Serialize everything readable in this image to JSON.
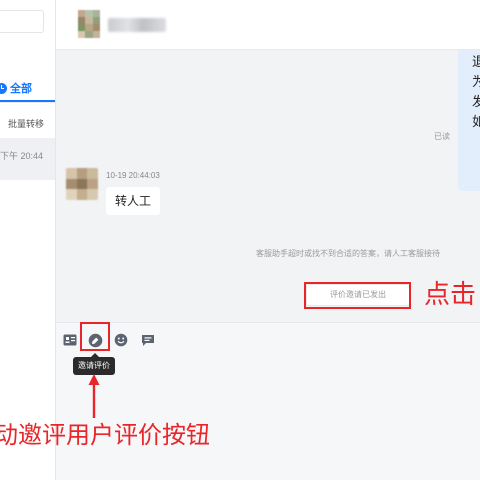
{
  "left_panel": {
    "active_tab": "全部",
    "batch_transfer": "批量转移",
    "conversation_time": "下午 20:44"
  },
  "header": {
    "contact_name": ""
  },
  "messages": {
    "outgoing_lines": [
      "退",
      "为",
      "发",
      "如"
    ],
    "read_status": "已读",
    "incoming_time": "10-19 20:44:03",
    "incoming_text": "转人工",
    "system_notice": "客服助手超时或找不到合适的答案，请人工客服接待",
    "invite_sent": "评价邀请已发出"
  },
  "toolbar": {
    "tooltip": "邀请评价",
    "tools": [
      "id-card-icon",
      "rate-invite-icon",
      "emoji-icon",
      "quick-reply-icon"
    ]
  },
  "annotations": {
    "click_hint": "点击",
    "main_caption": "动邀评用户评价按钮",
    "color": "#e8262a"
  },
  "colors": {
    "accent": "#1677ff",
    "bubble_out": "#e3eefc",
    "annotation": "#e8262a"
  }
}
